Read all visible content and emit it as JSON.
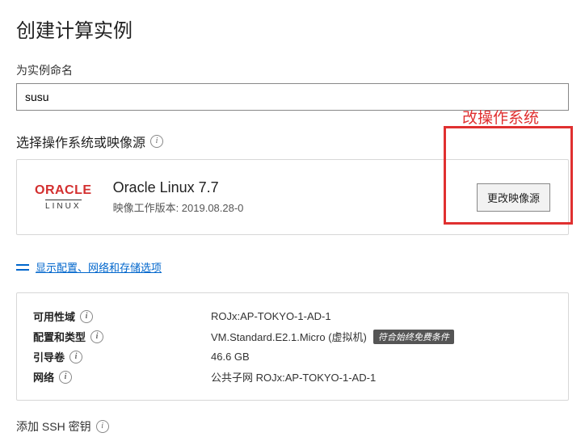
{
  "page": {
    "title": "创建计算实例"
  },
  "nameSection": {
    "label": "为实例命名",
    "value": "susu"
  },
  "osSection": {
    "label": "选择操作系统或映像源",
    "logo": {
      "brand": "ORACLE",
      "sub": "LINUX"
    },
    "osName": "Oracle Linux 7.7",
    "osVersionLabel": "映像工作版本: 2019.08.28-0",
    "changeButton": "更改映像源",
    "annotation": "改操作系统"
  },
  "optionsLink": "显示配置、网络和存储选项",
  "config": {
    "rows": [
      {
        "key": "可用性域",
        "value": "ROJx:AP-TOKYO-1-AD-1"
      },
      {
        "key": "配置和类型",
        "value": "VM.Standard.E2.1.Micro (虚拟机)",
        "badge": "符合始终免费条件"
      },
      {
        "key": "引导卷",
        "value": "46.6 GB"
      },
      {
        "key": "网络",
        "value": "公共子网 ROJx:AP-TOKYO-1-AD-1"
      }
    ]
  },
  "sshSection": {
    "label": "添加 SSH 密钥"
  }
}
